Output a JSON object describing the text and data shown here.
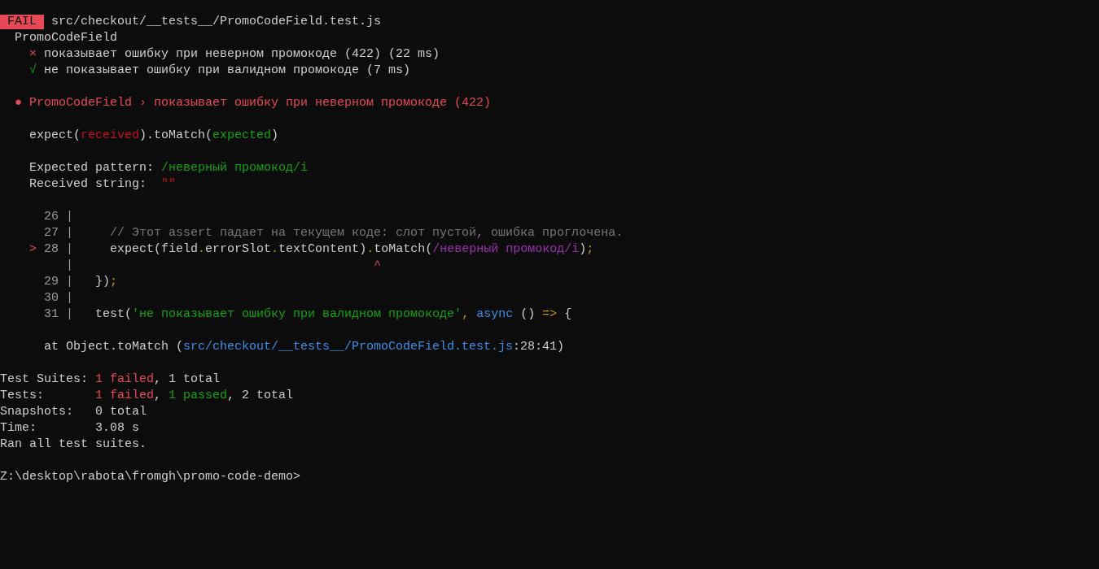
{
  "result": {
    "status": "FAIL",
    "passed": false,
    "file": "src/checkout/__tests__/PromoCodeField.test.js"
  },
  "suite": {
    "name": "PromoCodeField",
    "tests": [
      {
        "marker": "×",
        "title": "показывает ошибку при неверном промокоде (422)",
        "duration": "(22 ms)",
        "passed": false
      },
      {
        "marker": "√",
        "title": "не показывает ошибку при валидном промокоде",
        "duration": "(7 ms)",
        "passed": true
      }
    ]
  },
  "failure": {
    "bullet": "●",
    "title": "PromoCodeField › показывает ошибку при неверном промокоде (422)",
    "matcher_hint": [
      {
        "text": "expect(",
        "kind": "plain"
      },
      {
        "text": "received",
        "kind": "received"
      },
      {
        "text": ").toMatch(",
        "kind": "plain"
      },
      {
        "text": "expected",
        "kind": "expected"
      },
      {
        "text": ")",
        "kind": "plain"
      }
    ],
    "comparison": [
      {
        "label": "Expected pattern:",
        "value": "/неверный промокод/i",
        "kind": "expected"
      },
      {
        "label": "Received string:",
        "value": "\"\"",
        "kind": "received"
      }
    ],
    "code_frame": [
      {
        "number": "26",
        "gutter": "|"
      },
      {
        "number": "27",
        "gutter": "|",
        "code": [
          {
            "text": "    // Этот assert падает на текущем коде: слот пустой, ошибка проглочена.",
            "kind": "comment"
          }
        ]
      },
      {
        "number": "28",
        "pointer": ">",
        "gutter": "|",
        "code": [
          {
            "text": "    expect(field",
            "kind": "plain"
          },
          {
            "text": ".",
            "kind": "punct"
          },
          {
            "text": "errorSlot",
            "kind": "plain"
          },
          {
            "text": ".",
            "kind": "punct"
          },
          {
            "text": "textContent)",
            "kind": "plain"
          },
          {
            "text": ".",
            "kind": "punct"
          },
          {
            "text": "toMatch(",
            "kind": "plain"
          },
          {
            "text": "/неверный промокод/i",
            "kind": "regex"
          },
          {
            "text": ")",
            "kind": "plain"
          },
          {
            "text": ";",
            "kind": "punct"
          }
        ]
      },
      {
        "gutter": "|",
        "code": [
          {
            "text": "                                        ^",
            "kind": "caret"
          }
        ]
      },
      {
        "number": "29",
        "gutter": "|",
        "code": [
          {
            "text": "  })",
            "kind": "plain"
          },
          {
            "text": ";",
            "kind": "punct"
          }
        ]
      },
      {
        "number": "30",
        "gutter": "|"
      },
      {
        "number": "31",
        "gutter": "|",
        "code": [
          {
            "text": "  test(",
            "kind": "plain"
          },
          {
            "text": "'не показывает ошибку при валидном промокоде'",
            "kind": "string"
          },
          {
            "text": ", ",
            "kind": "punct"
          },
          {
            "text": "async",
            "kind": "keyword"
          },
          {
            "text": " () ",
            "kind": "plain"
          },
          {
            "text": "=>",
            "kind": "punct"
          },
          {
            "text": " {",
            "kind": "plain"
          }
        ]
      }
    ],
    "stack": [
      {
        "text": "at Object.toMatch (",
        "kind": "plain"
      },
      {
        "text": "src/checkout/__tests__/PromoCodeField.test.js",
        "kind": "path"
      },
      {
        "text": ":28:41)",
        "kind": "plain"
      }
    ]
  },
  "summary": [
    {
      "label": "Test Suites:",
      "parts": [
        {
          "text": "1 failed",
          "kind": "failed"
        },
        {
          "text": ", 1 total",
          "kind": "plain"
        }
      ]
    },
    {
      "label": "Tests:",
      "parts": [
        {
          "text": "1 failed",
          "kind": "failed"
        },
        {
          "text": ", ",
          "kind": "plain"
        },
        {
          "text": "1 passed",
          "kind": "passed"
        },
        {
          "text": ", 2 total",
          "kind": "plain"
        }
      ]
    },
    {
      "label": "Snapshots:",
      "parts": [
        {
          "text": "0 total",
          "kind": "plain"
        }
      ]
    },
    {
      "label": "Time:",
      "parts": [
        {
          "text": "3.08 s",
          "kind": "plain"
        }
      ]
    }
  ],
  "summary_note": "Ran all test suites.",
  "prompt": "Z:\\desktop\\rabota\\fromgh\\promo-code-demo>"
}
